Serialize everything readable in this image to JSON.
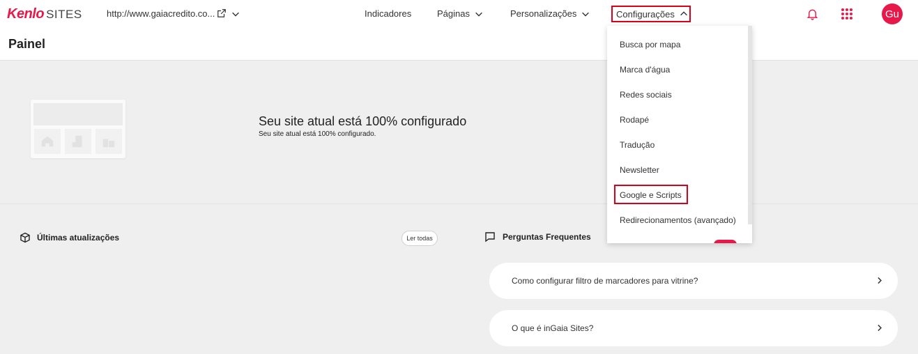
{
  "header": {
    "logo_brand": "Kenlo",
    "logo_product": "SITES",
    "site_url": "http://www.gaiacredito.co...",
    "nav": {
      "indicadores": "Indicadores",
      "paginas": "Páginas",
      "personalizacoes": "Personalizações",
      "configuracoes": "Configurações"
    },
    "avatar_initials": "Gu",
    "accent_color": "#e8194a"
  },
  "page": {
    "title": "Painel"
  },
  "banner": {
    "title": "Seu site atual está 100% configurado",
    "subtitle": "Seu site atual está 100% configurado."
  },
  "updates": {
    "title": "Últimas atualizações",
    "read_all": "Ler todas"
  },
  "faq": {
    "title": "Perguntas Frequentes",
    "items": [
      "Como configurar filtro de marcadores para vitrine?",
      "O que é inGaia Sites?"
    ]
  },
  "config_menu": {
    "items": [
      "Busca por mapa",
      "Marca d'água",
      "Redes sociais",
      "Rodapé",
      "Tradução",
      "Newsletter",
      "Google e Scripts",
      "Redirecionamentos (avançado)"
    ],
    "highlighted_item": "Google e Scripts"
  },
  "icons": {
    "external_link": "external-link-icon",
    "chevron_down": "chevron-down-icon",
    "chevron_up": "chevron-up-icon",
    "bell": "bell-icon",
    "apps": "apps-grid-icon",
    "box": "box-icon",
    "chat": "chat-bubble-icon",
    "chevron_right": "chevron-right-icon"
  }
}
